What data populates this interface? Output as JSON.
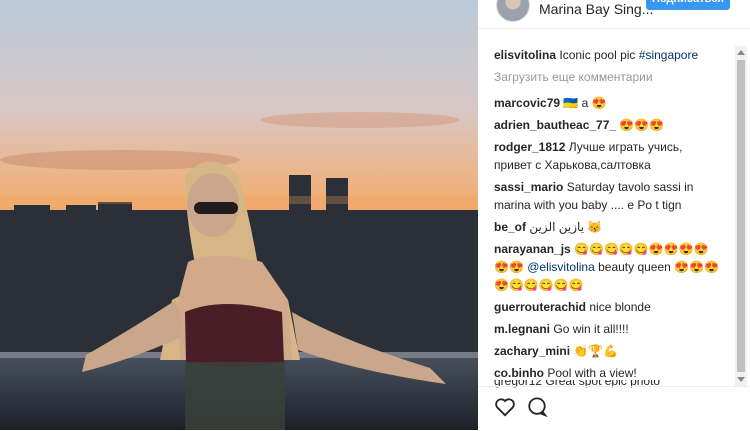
{
  "header": {
    "location": "Marina Bay Sing...",
    "follow_label": "Подписаться"
  },
  "comments": {
    "load_more": "Загрузить еще комментарии",
    "items": [
      {
        "user": "elisvitolina",
        "text": "Iconic pool pic ",
        "tag": "#singapore"
      },
      {
        "user": "marcovic79",
        "text": "🇺🇦 a 😍"
      },
      {
        "user": "adrien_bautheac_77_",
        "text": "😍😍😍"
      },
      {
        "user": "rodger_1812",
        "text": "Лучше играть учись, привет с Харькова,салтовка"
      },
      {
        "user": "sassi_mario",
        "text": "Saturday tavolo sassi in marina with you baby .... e Po t tign"
      },
      {
        "user": "be_of",
        "text": "يازين الزين 😽"
      },
      {
        "user": "narayanan_js",
        "text": "😋😋😋😋😋😍😍😍😍😍😍 ",
        "mention": "@elisvitolina",
        "text2": " beauty queen 😍😍😍😍😋😋😋😋😋"
      },
      {
        "user": "guerrouterachid",
        "text": "nice blonde"
      },
      {
        "user": "m.legnani",
        "text": "Go win it all!!!!"
      },
      {
        "user": "zachary_mini",
        "text": "👏🏆💪"
      },
      {
        "user": "co.binho",
        "text": "Pool with a view!"
      }
    ],
    "cut_line": "gregor12 Great spot epic photo"
  },
  "icons": {
    "like": "heart-icon",
    "comment": "comment-icon"
  }
}
